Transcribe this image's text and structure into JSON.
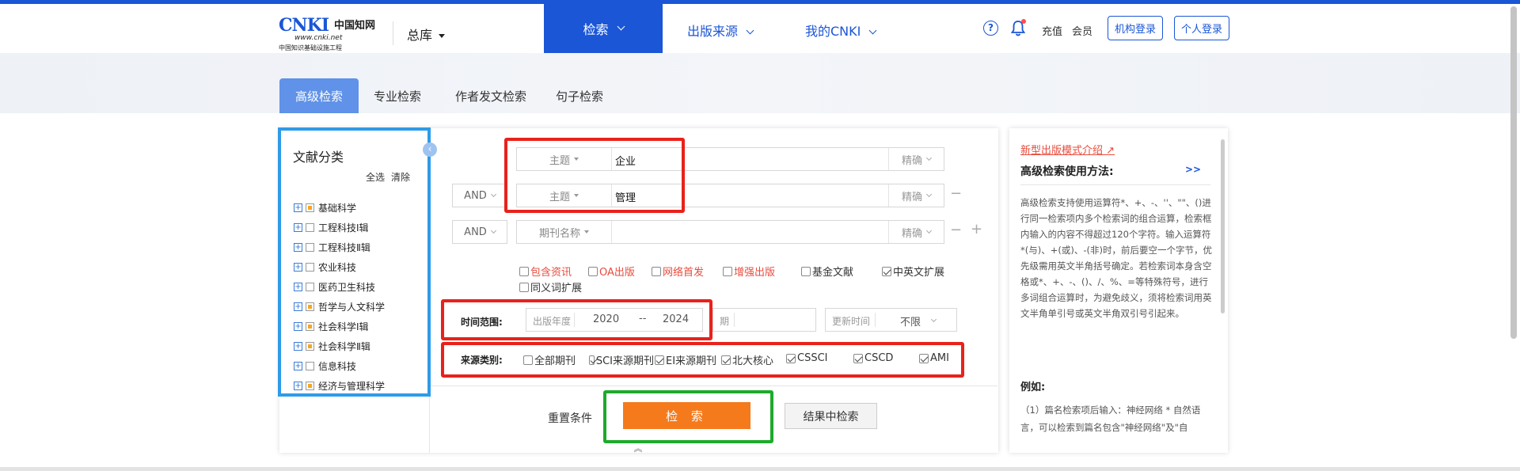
{
  "header": {
    "logo_mark": "CNKI",
    "logo_cn": "中国知网",
    "logo_url": "www.cnki.net",
    "logo_sub": "中国知识基础设施工程",
    "db_select": "总库",
    "nav": [
      {
        "label": "检索"
      },
      {
        "label": "出版来源"
      },
      {
        "label": "我的CNKI"
      }
    ],
    "help_glyph": "?",
    "recharge": "充值",
    "member": "会员",
    "org_login": "机构登录",
    "personal_login": "个人登录"
  },
  "tabs": [
    "高级检索",
    "专业检索",
    "作者发文检索",
    "句子检索"
  ],
  "category": {
    "title": "文献分类",
    "select_all": "全选",
    "clear": "清除",
    "collapse_glyph": "‹",
    "items": [
      {
        "label": "基础科学",
        "partial": true
      },
      {
        "label": "工程科技Ⅰ辑",
        "partial": false
      },
      {
        "label": "工程科技Ⅱ辑",
        "partial": false
      },
      {
        "label": "农业科技",
        "partial": false
      },
      {
        "label": "医药卫生科技",
        "partial": false
      },
      {
        "label": "哲学与人文科学",
        "partial": true
      },
      {
        "label": "社会科学Ⅰ辑",
        "partial": true
      },
      {
        "label": "社会科学Ⅱ辑",
        "partial": true
      },
      {
        "label": "信息科技",
        "partial": false
      },
      {
        "label": "经济与管理科学",
        "partial": true
      }
    ]
  },
  "search": {
    "rows": [
      {
        "field": "主题",
        "value": "企业",
        "match": "精确"
      },
      {
        "op": "AND",
        "field": "主题",
        "value": "管理",
        "match": "精确"
      },
      {
        "op": "AND",
        "field": "期刊名称",
        "value": "",
        "match": "精确"
      }
    ],
    "minus": "−",
    "plus": "+",
    "options": [
      {
        "label": "包含资讯",
        "checked": false,
        "red": true
      },
      {
        "label": "OA出版",
        "checked": false,
        "red": true
      },
      {
        "label": "网络首发",
        "checked": false,
        "red": true
      },
      {
        "label": "增强出版",
        "checked": false,
        "red": true
      },
      {
        "label": "基金文献",
        "checked": false,
        "red": false
      },
      {
        "label": "中英文扩展",
        "checked": true,
        "red": false
      },
      {
        "label": "同义词扩展",
        "checked": false,
        "red": false
      }
    ],
    "time": {
      "label": "时间范围:",
      "year_label": "出版年度",
      "from": "2020",
      "sep": "--",
      "to": "2024",
      "issue_label": "期",
      "update_label": "更新时间",
      "update_value": "不限"
    },
    "source": {
      "label": "来源类别:",
      "items": [
        {
          "label": "全部期刊",
          "checked": false
        },
        {
          "label": "SCI来源期刊",
          "checked": true
        },
        {
          "label": "EI来源期刊",
          "checked": true
        },
        {
          "label": "北大核心",
          "checked": true
        },
        {
          "label": "CSSCI",
          "checked": true
        },
        {
          "label": "CSCD",
          "checked": true
        },
        {
          "label": "AMI",
          "checked": true
        }
      ]
    },
    "reset": "重置条件",
    "submit": "检 索",
    "within": "结果中检索",
    "collapse_glyph": "︽"
  },
  "right_panel": {
    "link": "新型出版模式介绍 ↗",
    "title": "高级检索使用方法:",
    "more": ">>",
    "body": "高级检索支持使用运算符*、+、-、''、\"\"、()进行同一检索项内多个检索词的组合运算，检索框内输入的内容不得超过120个字符。输入运算符*(与)、+(或)、-(非)时，前后要空一个字节，优先级需用英文半角括号确定。若检索词本身含空格或*、+、-、()、/、%、=等特殊符号，进行多词组合运算时，为避免歧义，须将检索词用英文半角单引号或英文半角双引号引起来。",
    "example_title": "例如:",
    "example_body": "（1）篇名检索项后输入：神经网络 * 自然语言，可以检索到篇名包含\"神经网络\"及\"自"
  },
  "colors": {
    "brand_blue": "#1a56d6",
    "tab_blue": "#5f92e8",
    "search_orange": "#f57a1c",
    "highlight_red": "#e8221b",
    "highlight_green": "#1eaa2b",
    "highlight_blue": "#2e9be8"
  }
}
